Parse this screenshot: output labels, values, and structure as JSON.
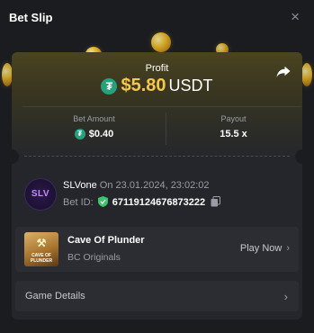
{
  "header": {
    "title": "Bet Slip",
    "close_icon": "×"
  },
  "profit": {
    "label": "Profit",
    "amount": "$5.80",
    "currency": "USDT",
    "coin_icon": "tether-icon"
  },
  "stats": {
    "bet_amount_label": "Bet Amount",
    "bet_amount_value": "$0.40",
    "payout_label": "Payout",
    "payout_value": "15.5 x"
  },
  "user": {
    "avatar_text": "SLV",
    "name": "SLVone",
    "date": "On 23.01.2024, 23:02:02",
    "bet_id_label": "Bet ID:",
    "bet_id": "671191246768732​22"
  },
  "game": {
    "name": "Cave Of Plunder",
    "provider": "BC Originals",
    "play_label": "Play Now",
    "thumb_text": "CAVE OF PLUNDER"
  },
  "details": {
    "label": "Game Details"
  },
  "colors": {
    "accent_gold": "#f5c84b",
    "tether_green": "#26a17b",
    "background": "#1a1c20"
  }
}
